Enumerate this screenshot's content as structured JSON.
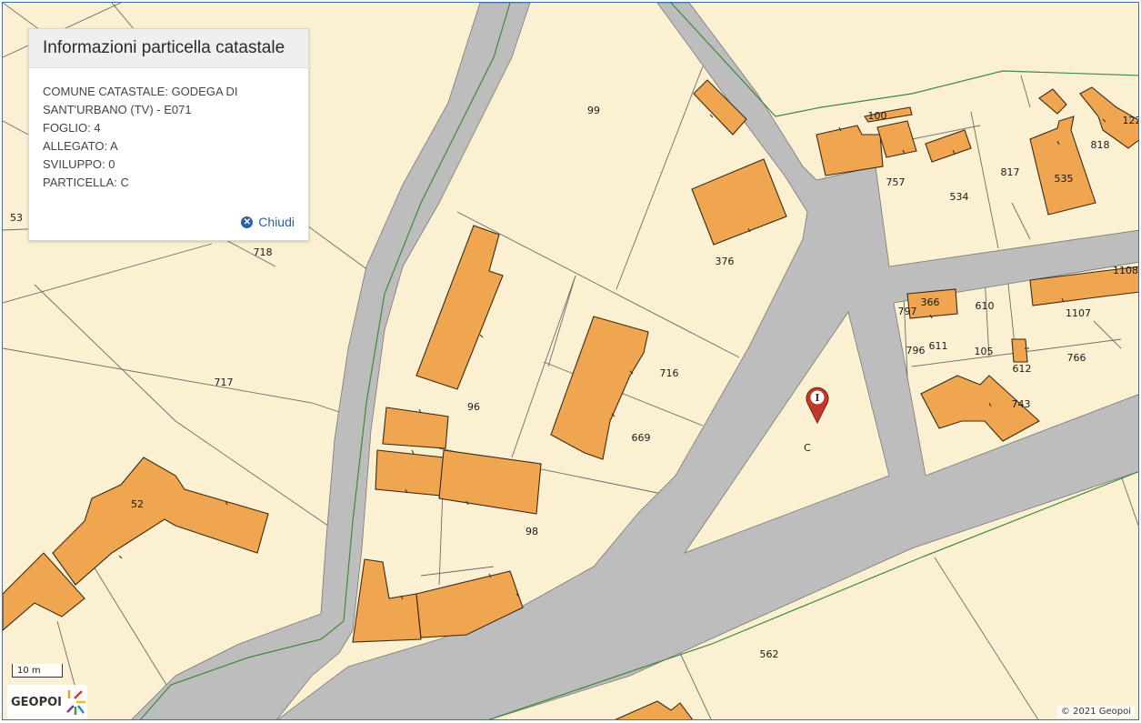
{
  "info_panel": {
    "title": "Informazioni particella catastale",
    "comune": "COMUNE CATASTALE: GODEGA DI\nSANT'URBANO (TV) - E071",
    "foglio": "FOGLIO: 4",
    "allegato": "ALLEGATO: A",
    "sviluppo": "SVILUPPO: 0",
    "particella": "PARTICELLA: C",
    "close_label": "Chiudi"
  },
  "map": {
    "scale_label": "10 m",
    "logo_text": "GEOPOI",
    "copyright": "© 2021 Geopoi",
    "marker_icon": "info-pin-icon",
    "colors": {
      "background": "#fcf0d2",
      "building": "#f0a650",
      "road": "#bdbdbd",
      "marker": "#c0392b",
      "link": "#2c5fa8"
    },
    "parcels": [
      "99",
      "100",
      "757",
      "534",
      "817",
      "535",
      "818",
      "122",
      "376",
      "718",
      "717",
      "96",
      "716",
      "669",
      "98",
      "52",
      "366",
      "610",
      "797",
      "1107",
      "1108",
      "796",
      "611",
      "105",
      "612",
      "766",
      "743",
      "C",
      "562",
      "53"
    ]
  }
}
